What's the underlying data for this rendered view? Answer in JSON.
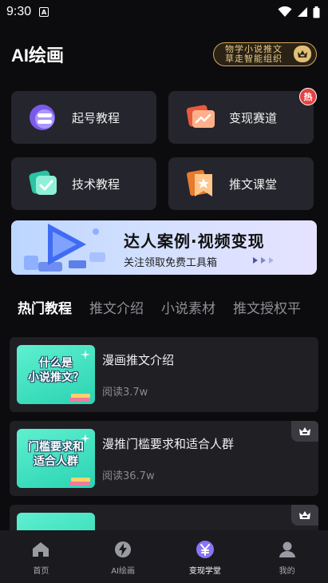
{
  "status": {
    "time": "9:30"
  },
  "header": {
    "title": "AI绘画",
    "vip_text": "物学小说推文\n草走智能组织"
  },
  "tiles": [
    {
      "label": "起号教程",
      "icon": "purple-toggle-icon"
    },
    {
      "label": "变现赛道",
      "icon": "chart-card-icon",
      "badge": "热"
    },
    {
      "label": "技术教程",
      "icon": "check-card-icon"
    },
    {
      "label": "推文课堂",
      "icon": "star-bookmark-icon"
    }
  ],
  "banner": {
    "title": "达人案例·视频变现",
    "subtitle": "关注领取免费工具箱"
  },
  "tabs": [
    "热门教程",
    "推文介绍",
    "小说素材",
    "推文授权平"
  ],
  "cards": [
    {
      "thumb_text": "什么是\n小说推文？",
      "title": "漫画推文介绍",
      "reads": "阅读3.7w",
      "vip": false
    },
    {
      "thumb_text": "门槛要求和\n适合人群",
      "title": "漫推门槛要求和适合人群",
      "reads": "阅读36.7w",
      "vip": true
    },
    {
      "thumb_text": "",
      "title": "",
      "reads": "",
      "vip": true
    }
  ],
  "nav": [
    {
      "label": "首页",
      "icon": "home-icon"
    },
    {
      "label": "AI绘画",
      "icon": "lightning-icon"
    },
    {
      "label": "变现学堂",
      "icon": "yuan-icon"
    },
    {
      "label": "我的",
      "icon": "user-icon"
    }
  ],
  "colors": {
    "accent": "#7b6cf6",
    "gold": "#d3a959",
    "hot": "#e84040",
    "thumb": "#2ad3b3"
  }
}
